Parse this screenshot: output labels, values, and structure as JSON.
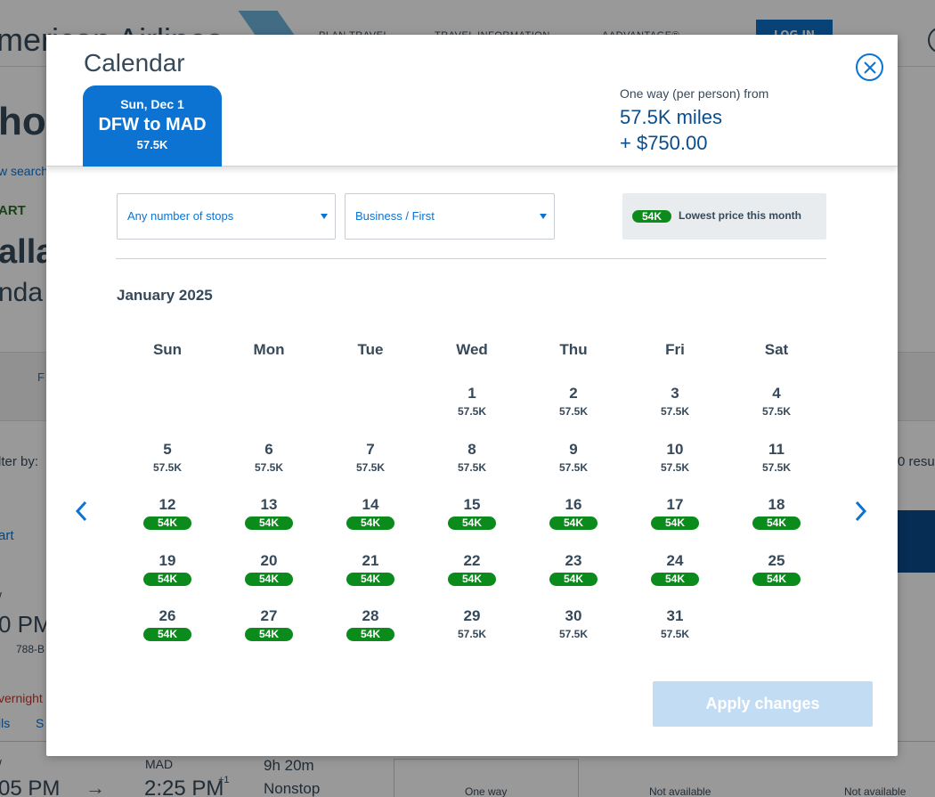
{
  "background": {
    "brand": "merican Airlines",
    "nav": [
      "PLAN TRAVEL",
      "TRAVEL INFORMATION",
      "AADVANTAGE®"
    ],
    "login": "LOG IN",
    "fragments": {
      "ho": "ho",
      "search": "w search",
      "art": "ART",
      "alla": "alla",
      "nda": "nda",
      "f": "F",
      "filter": "lter by:",
      "results": "0 resu",
      "sort": "art",
      "pm1": "0 PM",
      "aircraft": "788-B",
      "overnight": "vernight",
      "details": "ils",
      "s": "S",
      "pm2": "05 PM",
      "mad": "MAD",
      "arrive": "2:25 PM",
      "plus_one": "+1",
      "duration": "9h 20m",
      "nonstop": "Nonstop",
      "one_way": "One way",
      "na1": "Not available",
      "na2": "Not available",
      "v1": "/",
      "v2": "/"
    }
  },
  "modal": {
    "title": "Calendar",
    "segment": {
      "date": "Sun, Dec 1",
      "route": "DFW to MAD",
      "price": "57.5K"
    },
    "summary": {
      "label": "One way (per person) from",
      "miles": "57.5K miles",
      "cash": "+ $750.00"
    },
    "filters": {
      "stops": "Any number of stops",
      "cabin": "Business / First"
    },
    "legend": {
      "badge": "54K",
      "text": "Lowest price this month"
    },
    "month": "January 2025",
    "weekdays": [
      "Sun",
      "Mon",
      "Tue",
      "Wed",
      "Thu",
      "Fri",
      "Sat"
    ],
    "colors": {
      "accent": "#0d73d2",
      "lowest": "#0b8b1c",
      "text": "#36495a"
    },
    "days": [
      {
        "d": "1",
        "p": "57.5K",
        "low": false
      },
      {
        "d": "2",
        "p": "57.5K",
        "low": false
      },
      {
        "d": "3",
        "p": "57.5K",
        "low": false
      },
      {
        "d": "4",
        "p": "57.5K",
        "low": false
      },
      {
        "d": "5",
        "p": "57.5K",
        "low": false
      },
      {
        "d": "6",
        "p": "57.5K",
        "low": false
      },
      {
        "d": "7",
        "p": "57.5K",
        "low": false
      },
      {
        "d": "8",
        "p": "57.5K",
        "low": false
      },
      {
        "d": "9",
        "p": "57.5K",
        "low": false
      },
      {
        "d": "10",
        "p": "57.5K",
        "low": false
      },
      {
        "d": "11",
        "p": "57.5K",
        "low": false
      },
      {
        "d": "12",
        "p": "54K",
        "low": true
      },
      {
        "d": "13",
        "p": "54K",
        "low": true
      },
      {
        "d": "14",
        "p": "54K",
        "low": true
      },
      {
        "d": "15",
        "p": "54K",
        "low": true
      },
      {
        "d": "16",
        "p": "54K",
        "low": true
      },
      {
        "d": "17",
        "p": "54K",
        "low": true
      },
      {
        "d": "18",
        "p": "54K",
        "low": true
      },
      {
        "d": "19",
        "p": "54K",
        "low": true
      },
      {
        "d": "20",
        "p": "54K",
        "low": true
      },
      {
        "d": "21",
        "p": "54K",
        "low": true
      },
      {
        "d": "22",
        "p": "54K",
        "low": true
      },
      {
        "d": "23",
        "p": "54K",
        "low": true
      },
      {
        "d": "24",
        "p": "54K",
        "low": true
      },
      {
        "d": "25",
        "p": "54K",
        "low": true
      },
      {
        "d": "26",
        "p": "54K",
        "low": true
      },
      {
        "d": "27",
        "p": "54K",
        "low": true
      },
      {
        "d": "28",
        "p": "54K",
        "low": true
      },
      {
        "d": "29",
        "p": "57.5K",
        "low": false
      },
      {
        "d": "30",
        "p": "57.5K",
        "low": false
      },
      {
        "d": "31",
        "p": "57.5K",
        "low": false
      }
    ],
    "apply": "Apply changes"
  }
}
